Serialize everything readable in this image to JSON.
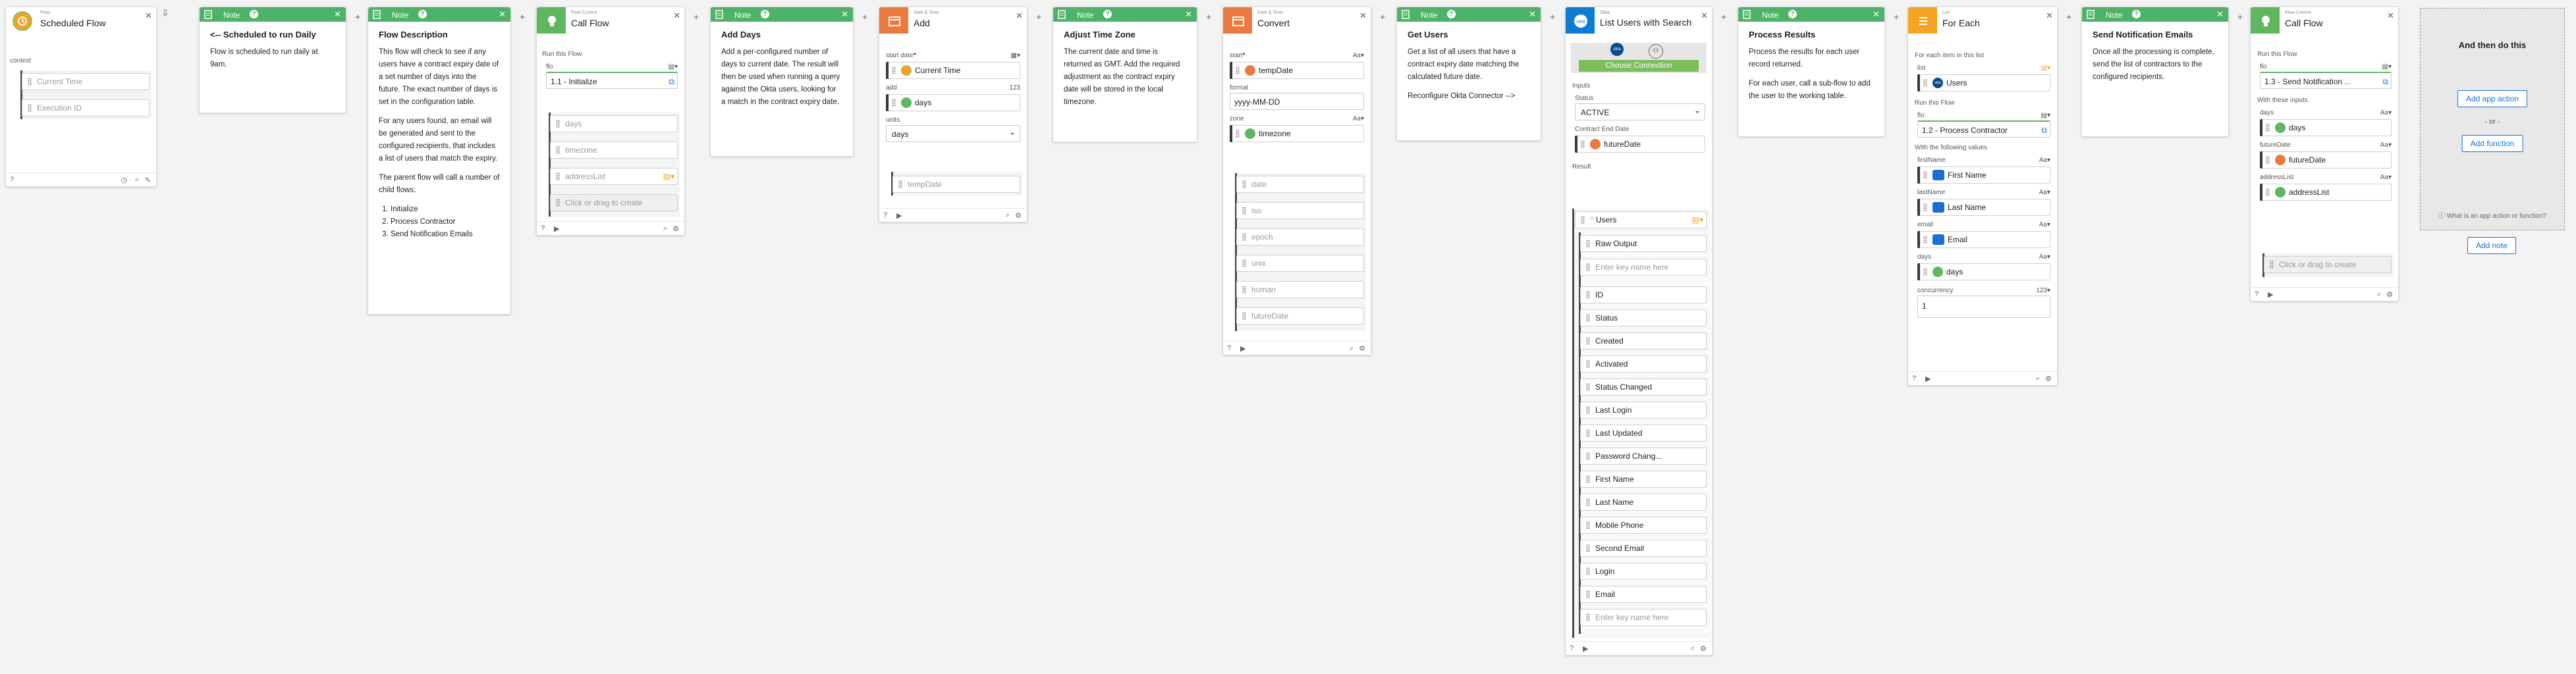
{
  "cards": {
    "scheduled": {
      "tag": "Flow",
      "title": "Scheduled Flow",
      "context": "context",
      "fields": [
        "Current Time",
        "Execution ID"
      ]
    },
    "note1": {
      "header": "Note",
      "title": "<-- Scheduled to run Daily",
      "text": "Flow is scheduled to run daily at 9am."
    },
    "note2": {
      "header": "Note",
      "title": "Flow Description",
      "p1": "This flow will check to see if any users have a contract expiry date of a set number of days into the future. The exact number of days is set in the configuration table.",
      "p2": "For any users found, an email will be generated and sent to the configured recipients, that includes a list of users that match the expiry.",
      "p3": "The parent flow will call a number of child flows:",
      "list": [
        "Initialize",
        "Process Contractor",
        "Send Notification Emails"
      ]
    },
    "call1": {
      "tag": "Flow Control",
      "title": "Call Flow",
      "run_label": "Run this Flow",
      "flo_label": "flo",
      "flo_value": "1.1 - Initialize",
      "outputs": [
        "days",
        "timezone",
        "addressList"
      ],
      "create_ph": "Click or drag to create"
    },
    "note3": {
      "header": "Note",
      "title": "Add Days",
      "text": "Add a per-configured number of days to current date. The result will then be used when running a query against the Okta users, looking for a match in the contract expiry date."
    },
    "add": {
      "tag": "Date & Time",
      "title": "Add",
      "start_label": "start date",
      "start_req": "*",
      "start_value": "Current Time",
      "add_label": "add",
      "add_type": "123",
      "add_value": "days",
      "units_label": "units",
      "units_value": "days",
      "output": "tempDate"
    },
    "note4": {
      "header": "Note",
      "title": "Adjust Time Zone",
      "text": "The current date and time is returned as GMT. Add the required adjustment as the contract expiry date will be stored in the local timezone."
    },
    "convert": {
      "tag": "Date & Time",
      "title": "Convert",
      "start_label": "start",
      "start_req": "*",
      "start_value": "tempDate",
      "type_label": "A",
      "format_label": "format",
      "format_value": "yyyy-MM-DD",
      "zone_label": "zone",
      "zone_value": "timezone",
      "outputs": [
        "date",
        "iso",
        "epoch",
        "unix",
        "human",
        "futureDate"
      ]
    },
    "note5": {
      "header": "Note",
      "title": "Get Users",
      "text": "Get a list of all users that have a contract expiry date matching the calculated future date.",
      "text2": "Reconfigure Okta Connector -->"
    },
    "okta": {
      "tag": "Okta",
      "title": "List Users with Search",
      "btn": "Choose Connection",
      "inputs_label": "Inputs",
      "status_label": "Status",
      "status_value": "ACTIVE",
      "ced_label": "Contract End Date",
      "ced_value": "futureDate",
      "result_label": "Result",
      "users_label": "Users",
      "raw": "Raw Output",
      "key_ph": "Enter key name here",
      "fields": [
        "ID",
        "Status",
        "Created",
        "Activated",
        "Status Changed",
        "Last Login",
        "Last Updated",
        "Password Chang...",
        "First Name",
        "Last Name",
        "Mobile Phone",
        "Second Email",
        "Login",
        "Email"
      ],
      "key_ph2": "Enter key name here"
    },
    "note6": {
      "header": "Note",
      "title": "Process Results",
      "text": "Process the results for each user record returned.",
      "text2": "For each user, call a sub-flow to add the user to the working table."
    },
    "foreach": {
      "tag": "List",
      "title": "For Each",
      "each_label": "For each item in this list",
      "list_label": "list",
      "list_value": "Users",
      "run_label": "Run this Flow",
      "flo_label": "flo",
      "flo_value": "1.2 - Process Contractor",
      "with_label": "With the following values",
      "values": [
        {
          "label": "firstName",
          "value": "First Name"
        },
        {
          "label": "lastName",
          "value": "Last Name"
        },
        {
          "label": "email",
          "value": "Email"
        },
        {
          "label": "days",
          "value": "days"
        }
      ],
      "conc_label": "concurrency",
      "conc_value": "1"
    },
    "note7": {
      "header": "Note",
      "title": "Send Notification Emails",
      "text": "Once all the processing is complete, send the list of contractors to the configured recipients."
    },
    "call2": {
      "tag": "Flow Control",
      "title": "Call Flow",
      "run_label": "Run this Flow",
      "flo_label": "flo",
      "flo_value": "1.3 - Send Notification ...",
      "with_label": "With these inputs",
      "inputs": [
        {
          "label": "days",
          "value": "days"
        },
        {
          "label": "futureDate",
          "value": "futureDate"
        },
        {
          "label": "addressList",
          "value": "addressList"
        }
      ],
      "create_ph": "Click or drag to create"
    },
    "andthen": {
      "title": "And then do this",
      "btn1": "Add app action",
      "or": "- or -",
      "btn2": "Add function",
      "help": "What is an app action or function?"
    },
    "addnote": "Add note"
  },
  "colors": {
    "green": "#5fb760",
    "orange": "#ec7a40",
    "blue": "#1c6fd1",
    "note": "#4db368"
  }
}
